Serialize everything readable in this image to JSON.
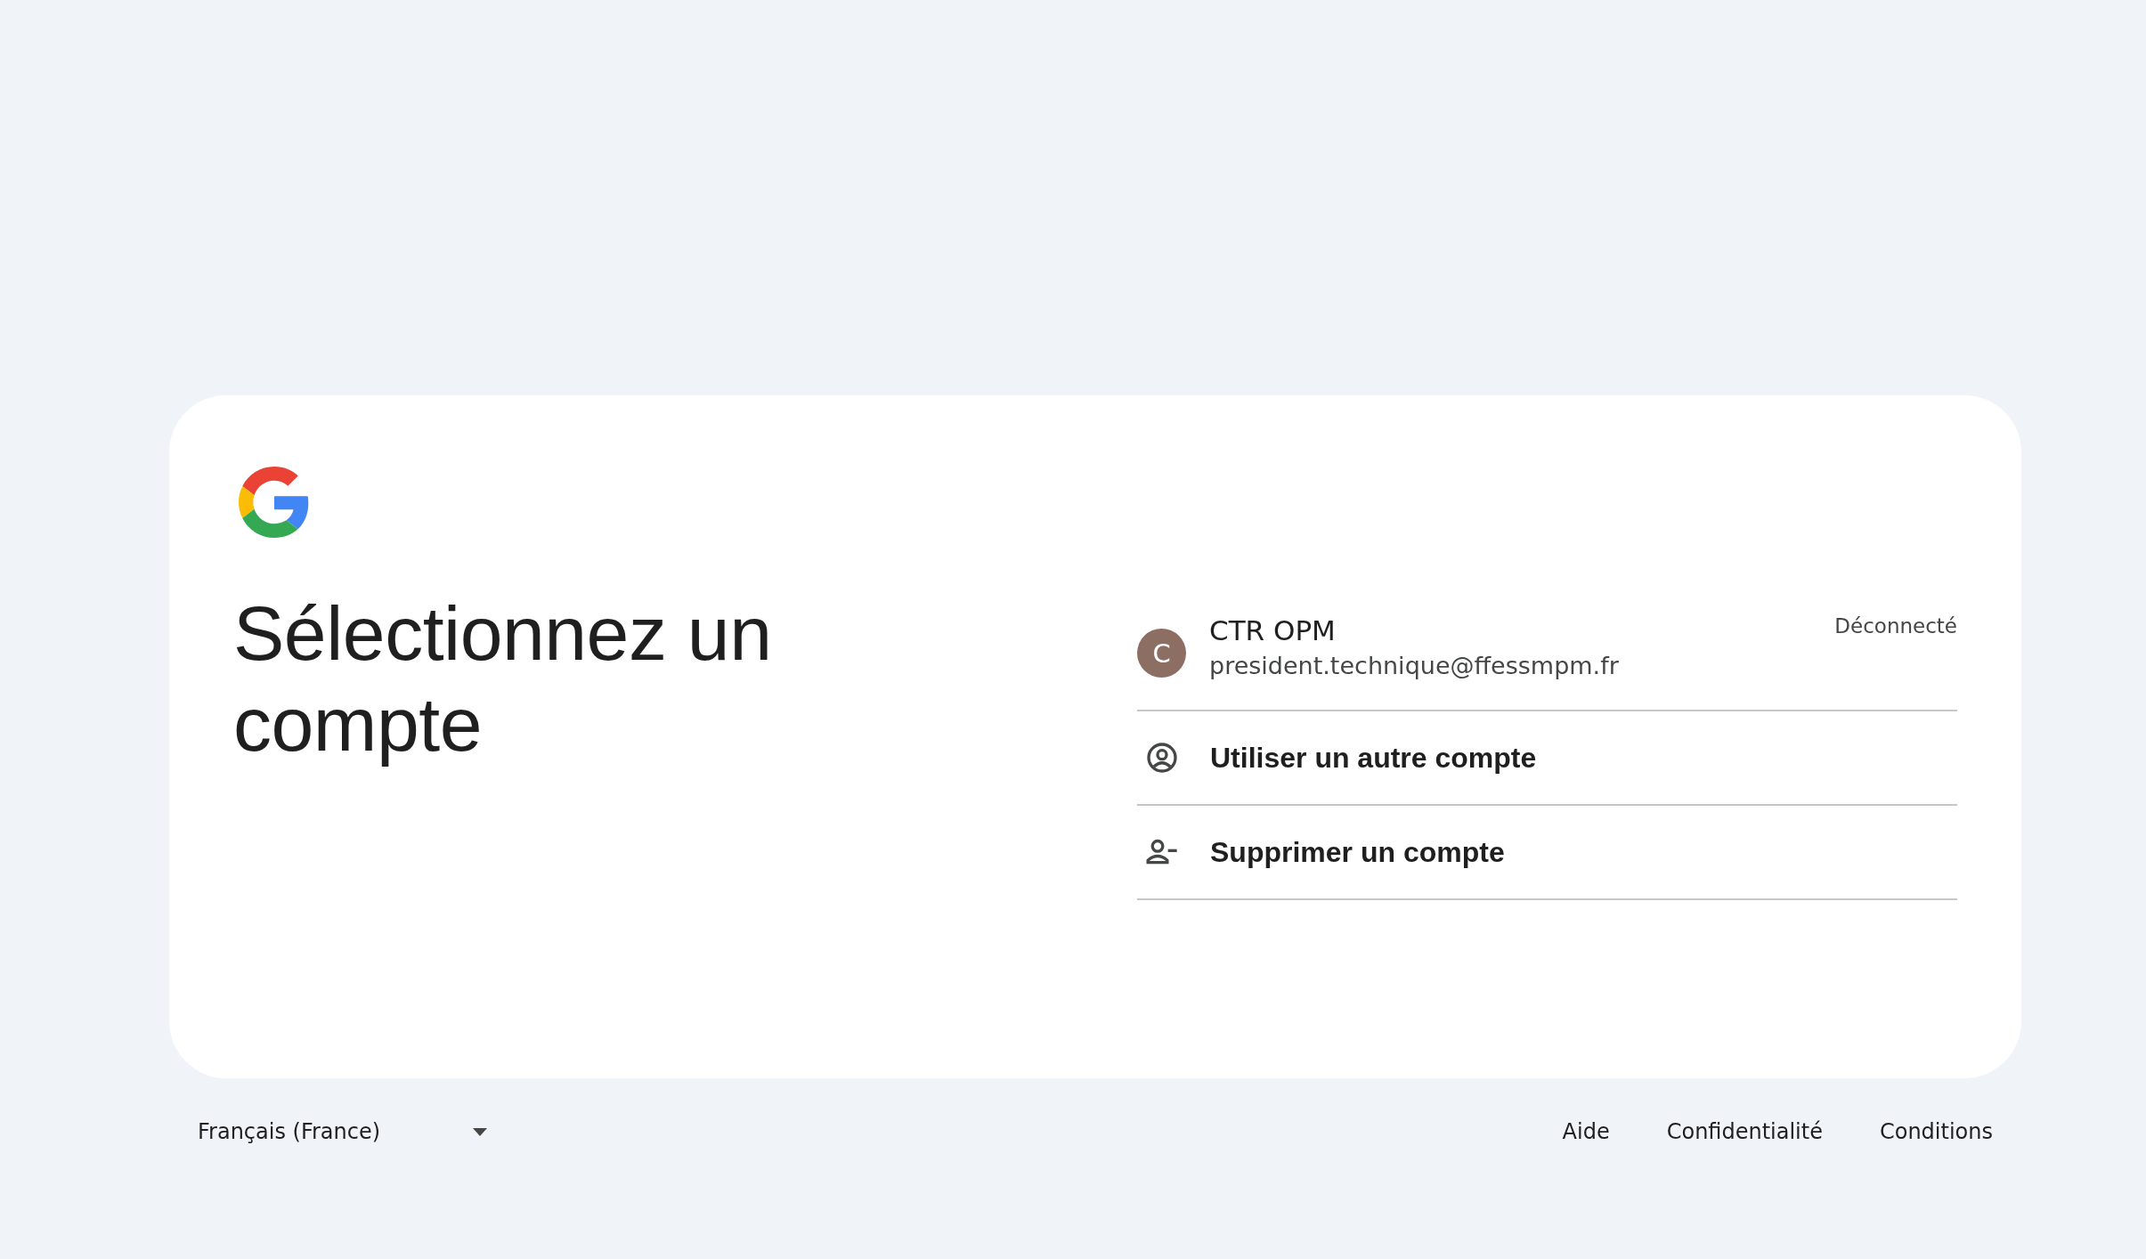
{
  "title": "Sélectionnez un compte",
  "accounts": [
    {
      "initial": "C",
      "name": "CTR OPM",
      "email": "president.technique@ffessmpm.fr",
      "status": "Déconnecté"
    }
  ],
  "actions": [
    {
      "kind": "use-other",
      "label": "Utiliser un autre compte"
    },
    {
      "kind": "remove",
      "label": "Supprimer un compte"
    }
  ],
  "footer": {
    "language": "Français (France)",
    "links": [
      "Aide",
      "Confidentialité",
      "Conditions"
    ]
  }
}
